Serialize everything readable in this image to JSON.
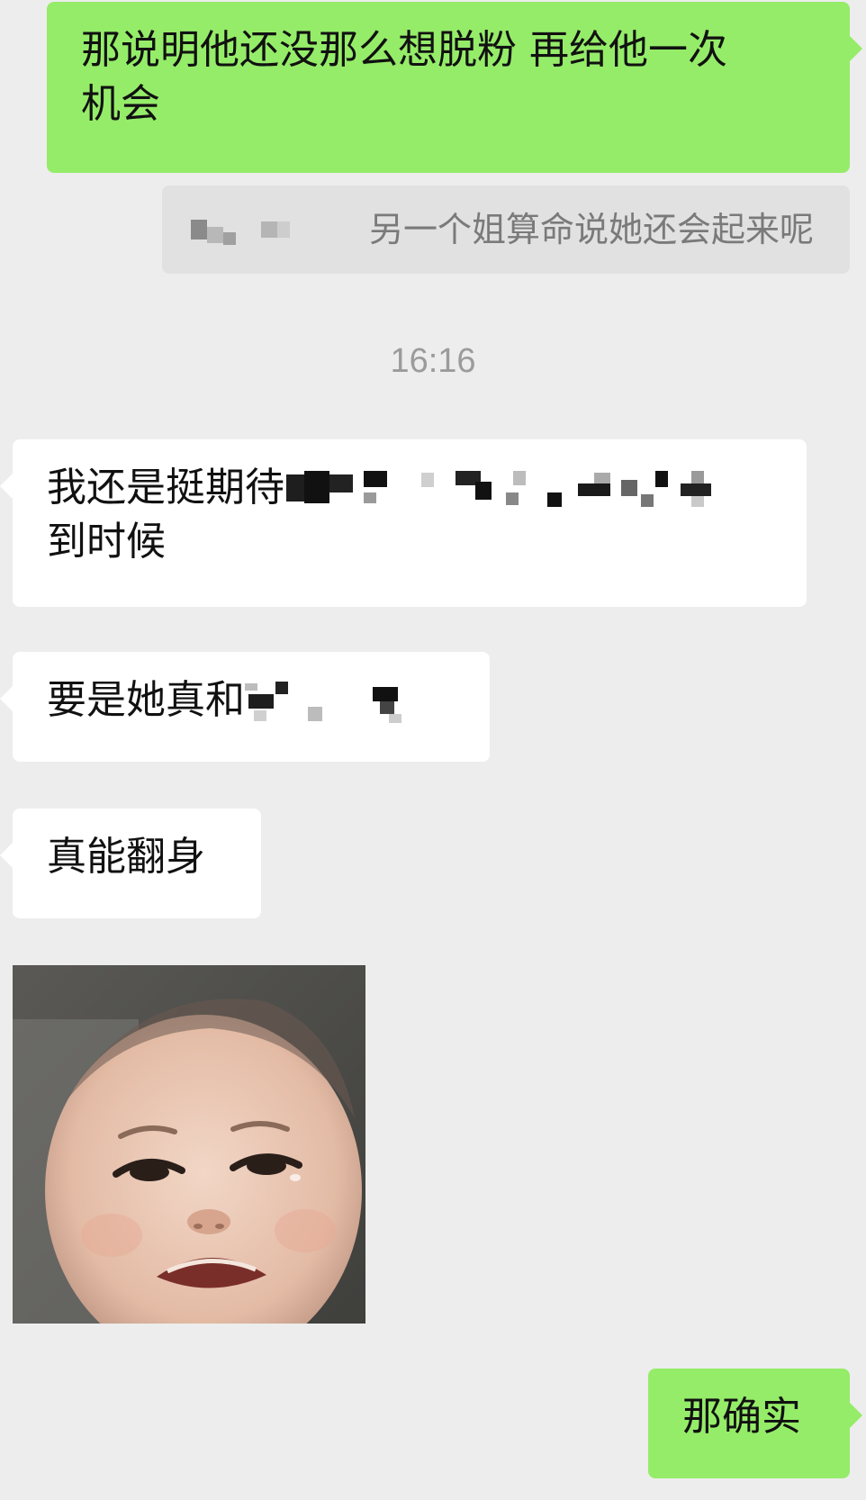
{
  "messages": [
    {
      "id": "m1",
      "direction": "outgoing",
      "text_line1": "那说明他还没那么想脱粉 再给他一次",
      "text_line2": "机会"
    },
    {
      "id": "m2",
      "type": "quote",
      "quoted_text": "另一个姐算命说她还会起来呢"
    },
    {
      "id": "m3",
      "type": "timestamp",
      "text": "16:16"
    },
    {
      "id": "m4",
      "direction": "incoming",
      "text_line1": "我还是挺期待",
      "text_line2": "到时候"
    },
    {
      "id": "m5",
      "direction": "incoming",
      "text": "要是她真和"
    },
    {
      "id": "m6",
      "direction": "incoming",
      "text": "真能翻身"
    },
    {
      "id": "m7",
      "direction": "incoming",
      "type": "sticker",
      "sticker": "crying-baby-sticker"
    },
    {
      "id": "m8",
      "direction": "outgoing",
      "text": "那确实"
    }
  ],
  "colors": {
    "background": "#ededed",
    "outgoing_bubble": "#95ec69",
    "incoming_bubble": "#ffffff",
    "quote_background": "#e1e1e1",
    "timestamp_text": "#9b9b9b"
  }
}
